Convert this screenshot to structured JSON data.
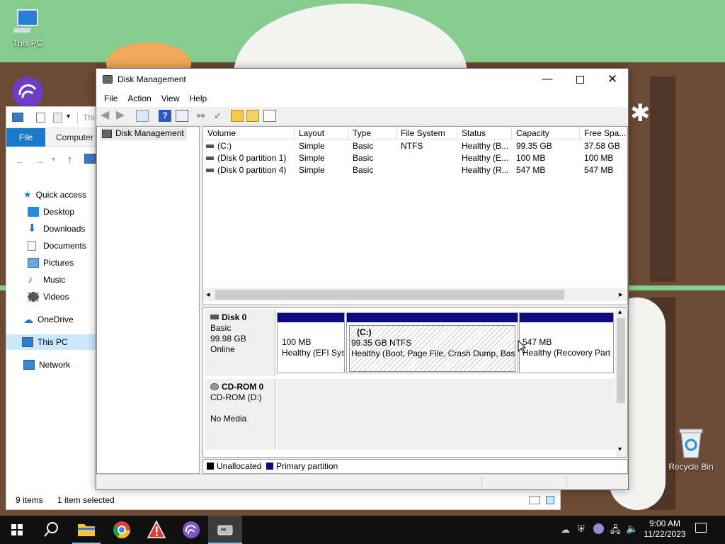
{
  "desktop": {
    "icons": [
      {
        "label": "This PC",
        "icon": "monitor-icon"
      },
      {
        "label": "Recycle Bin",
        "icon": "recycle-bin-icon"
      }
    ]
  },
  "explorer": {
    "address_partial": "Thi",
    "ribbon_tabs": [
      "File",
      "Computer"
    ],
    "nav": {
      "quick_access": "Quick access",
      "items": [
        "Desktop",
        "Downloads",
        "Documents",
        "Pictures",
        "Music",
        "Videos"
      ],
      "onedrive": "OneDrive",
      "this_pc": "This PC",
      "network": "Network"
    },
    "status": {
      "items": "9 items",
      "selected": "1 item selected"
    }
  },
  "dm": {
    "title": "Disk Management",
    "menu": [
      "File",
      "Action",
      "View",
      "Help"
    ],
    "tree_root": "Disk Management",
    "columns": [
      "Volume",
      "Layout",
      "Type",
      "File System",
      "Status",
      "Capacity",
      "Free Spa..."
    ],
    "rows": [
      {
        "volume": "(C:)",
        "layout": "Simple",
        "type": "Basic",
        "fs": "NTFS",
        "status": "Healthy (B...",
        "capacity": "99.35 GB",
        "free": "37.58 GB"
      },
      {
        "volume": "(Disk 0 partition 1)",
        "layout": "Simple",
        "type": "Basic",
        "fs": "",
        "status": "Healthy (E...",
        "capacity": "100 MB",
        "free": "100 MB"
      },
      {
        "volume": "(Disk 0 partition 4)",
        "layout": "Simple",
        "type": "Basic",
        "fs": "",
        "status": "Healthy (R...",
        "capacity": "547 MB",
        "free": "547 MB"
      }
    ],
    "disk0": {
      "name": "Disk 0",
      "kind": "Basic",
      "size": "99.98 GB",
      "state": "Online",
      "partitions": [
        {
          "line1": "100 MB",
          "line2": "Healthy (EFI Sys"
        },
        {
          "title": "(C:)",
          "line1": "99.35 GB NTFS",
          "line2": "Healthy (Boot, Page File, Crash Dump, Basic"
        },
        {
          "line1": "547 MB",
          "line2": "Healthy (Recovery Part"
        }
      ]
    },
    "cdrom": {
      "name": "CD-ROM 0",
      "drive": "CD-ROM (D:)",
      "media": "No Media"
    },
    "legend": {
      "unallocated": "Unallocated",
      "primary": "Primary partition"
    },
    "colors": {
      "partition_bar": "#0b0b82",
      "unallocated": "#000000"
    }
  },
  "taskbar": {
    "apps": [
      "start-icon",
      "search-icon",
      "file-explorer-icon",
      "chrome-icon",
      "warning-app-icon",
      "torrent-app-icon",
      "disk-management-icon"
    ],
    "time": "9:00 AM",
    "date": "11/22/2023"
  }
}
